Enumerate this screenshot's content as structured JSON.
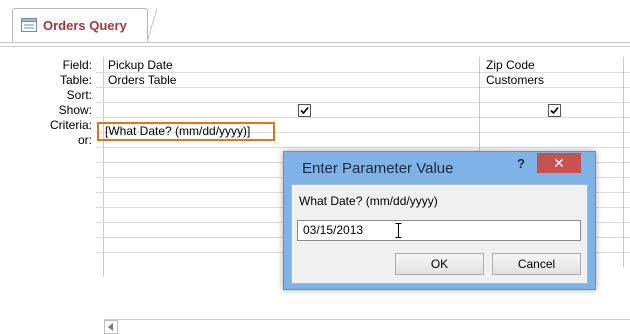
{
  "tab": {
    "title": "Orders Query",
    "icon": "query-icon"
  },
  "row_labels": [
    "Field:",
    "Table:",
    "Sort:",
    "Show:",
    "Criteria:",
    "or:"
  ],
  "columns": [
    {
      "field": "Pickup Date",
      "table": "Orders Table",
      "show": true,
      "criteria": "[What Date? (mm/dd/yyyy)]"
    },
    {
      "field": "Zip Code",
      "table": "Customers",
      "show": true,
      "criteria": ""
    }
  ],
  "dialog": {
    "title": "Enter Parameter Value",
    "help_label": "?",
    "close_label": "✕",
    "prompt": "What Date? (mm/dd/yyyy)",
    "input_value": "03/15/2013",
    "ok_label": "OK",
    "cancel_label": "Cancel"
  },
  "colors": {
    "tab_text": "#a4373a",
    "criteria_highlight": "#e07521",
    "dialog_frame": "#7fb2e6",
    "close_button": "#c75050"
  }
}
